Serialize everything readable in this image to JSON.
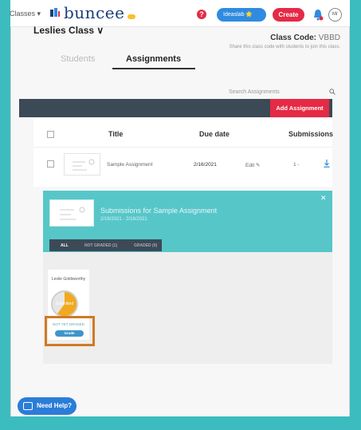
{
  "topbar": {
    "classes_menu": "Classes ▾",
    "logo_text": "buncee",
    "user_pill": "Ideaslab 🌟",
    "create_button": "Create",
    "avatar_initials": "Mr"
  },
  "class": {
    "name": "Leslies Class ∨",
    "code_label": "Class Code:",
    "code_value": "VBBD",
    "code_hint": "Share this class code with students to join this class."
  },
  "tabs": {
    "students": "Students",
    "assignments": "Assignments"
  },
  "toolbar": {
    "search_placeholder": "Search Assignments",
    "add_assignment": "Add Assignment"
  },
  "table": {
    "headers": [
      "Title",
      "Due date",
      "Submissions"
    ],
    "rows": [
      {
        "title": "Sample Assignment",
        "due": "2/16/2021",
        "edit": "Edit ✎",
        "submissions": "1 -"
      }
    ]
  },
  "banner": {
    "title": "Submissions for Sample Assignment",
    "dates": "2/16/2021 - 2/16/2021",
    "close": "✕",
    "filters": [
      "ALL",
      "NOT GRADED (1)",
      "GRADED (0)"
    ]
  },
  "student": {
    "name": "Leslie Goldsworthy",
    "pie_label": "Submitted",
    "status": "NOT YET GRADED",
    "grade_button": "Grade",
    "pie_fraction": 0.6
  },
  "help": {
    "label": "Need Help?"
  },
  "colors": {
    "teal": "#3cbcbf",
    "brand_red": "#e52a45",
    "brand_blue": "#2f8be0",
    "highlight": "#d07a23"
  }
}
